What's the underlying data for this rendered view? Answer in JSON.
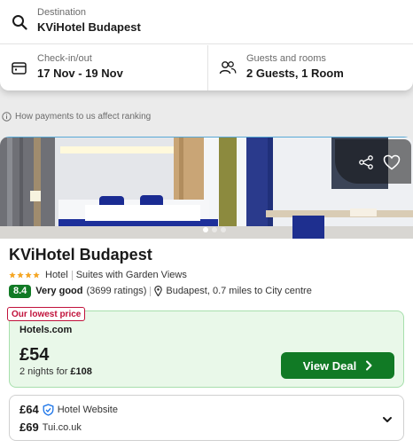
{
  "search": {
    "destination_label": "Destination",
    "destination_value": "KViHotel Budapest",
    "dates_label": "Check-in/out",
    "dates_value": "17 Nov - 19 Nov",
    "guests_label": "Guests and rooms",
    "guests_value": "2 Guests, 1 Room"
  },
  "ranking_note": "How payments to us affect ranking",
  "hotel": {
    "name": "KViHotel Budapest",
    "star_rating": 4,
    "type": "Hotel",
    "feature": "Suites with Garden Views",
    "score": "8.4",
    "score_label": "Very good",
    "ratings_count": "(3699 ratings)",
    "location": "Budapest, 0.7 miles to City centre",
    "photo_count": 3,
    "photo_active": 0
  },
  "deal": {
    "badge": "Our lowest price",
    "provider": "Hotels.com",
    "price": "£54",
    "nights_text": "2 nights for",
    "nights_total": "£108",
    "button_label": "View Deal"
  },
  "other_offers": [
    {
      "price": "£64",
      "source": "Hotel Website",
      "verified": true
    },
    {
      "price": "£69",
      "source": "Tui.co.uk",
      "verified": false
    }
  ],
  "colors": {
    "accent_green": "#117a25",
    "deal_background": "#e9f8e9",
    "badge_red": "#c1123b"
  },
  "icons": {
    "destination": "search-icon",
    "dates": "calendar-icon",
    "guests": "people-icon",
    "ranking": "info-icon",
    "share": "share-icon",
    "favorite": "heart-icon",
    "location": "location-pin-icon",
    "verified": "shield-check-icon",
    "expand": "chevron-down-icon"
  }
}
